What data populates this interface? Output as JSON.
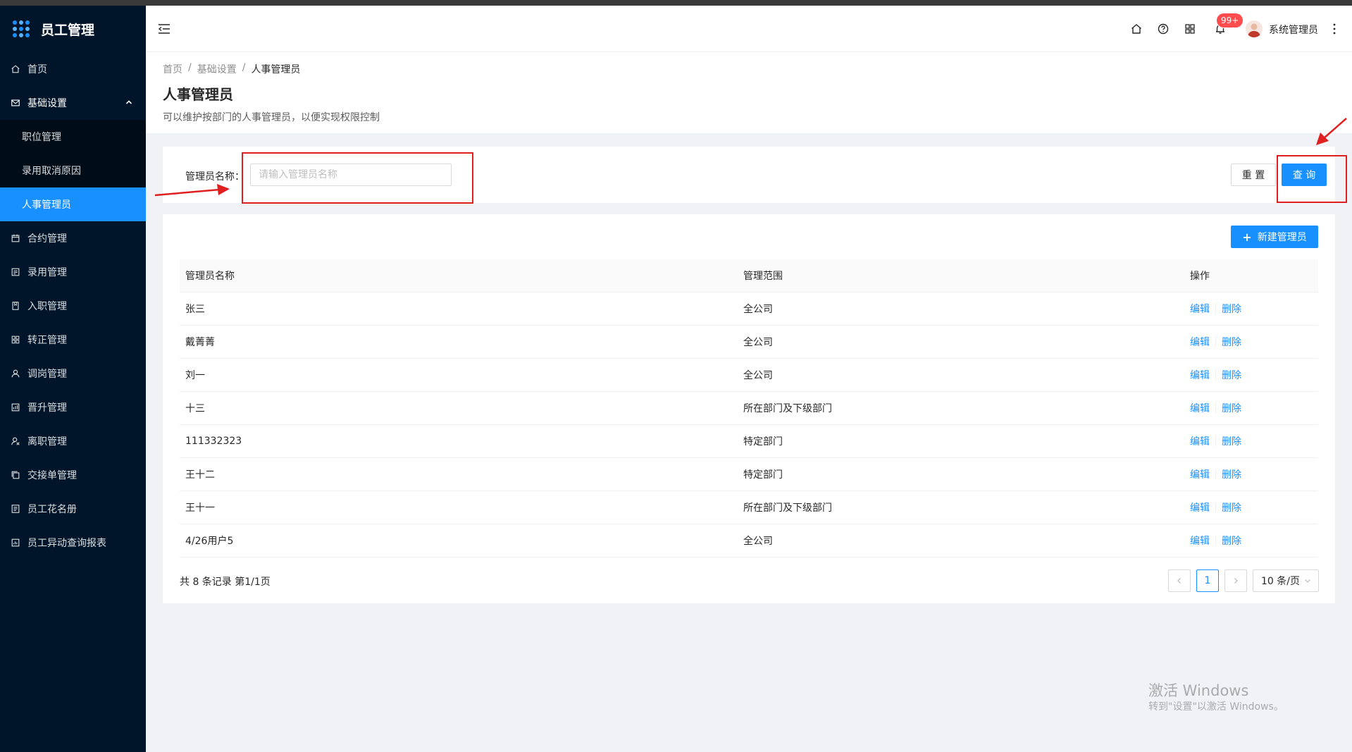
{
  "app": {
    "title": "员工管理"
  },
  "sidebar": {
    "items": [
      {
        "label": "首页",
        "icon": "home-icon"
      },
      {
        "label": "基础设置",
        "icon": "mail-icon",
        "open": true
      },
      {
        "label": "合约管理",
        "icon": "calendar-icon"
      },
      {
        "label": "录用管理",
        "icon": "profile-icon"
      },
      {
        "label": "入职管理",
        "icon": "book-icon"
      },
      {
        "label": "转正管理",
        "icon": "apps-icon"
      },
      {
        "label": "调岗管理",
        "icon": "user-icon"
      },
      {
        "label": "晋升管理",
        "icon": "rise-icon"
      },
      {
        "label": "离职管理",
        "icon": "user-delete-icon"
      },
      {
        "label": "交接单管理",
        "icon": "copy-icon"
      },
      {
        "label": "员工花名册",
        "icon": "list-icon"
      },
      {
        "label": "员工异动查询报表",
        "icon": "report-icon"
      }
    ],
    "submenu": [
      {
        "label": "职位管理"
      },
      {
        "label": "录用取消原因"
      },
      {
        "label": "人事管理员",
        "active": true
      }
    ]
  },
  "header": {
    "notification_count": "99+",
    "username": "系统管理员"
  },
  "breadcrumb": [
    "首页",
    "基础设置",
    "人事管理员"
  ],
  "page": {
    "title": "人事管理员",
    "description": "可以维护按部门的人事管理员，以便实现权限控制"
  },
  "search": {
    "label": "管理员名称：",
    "placeholder": "请输入管理员名称",
    "value": "",
    "reset_label": "重 置",
    "query_label": "查 询"
  },
  "table": {
    "new_label": "新建管理员",
    "columns": [
      "管理员名称",
      "管理范围",
      "操作"
    ],
    "rows": [
      {
        "name": "张三",
        "scope": "全公司"
      },
      {
        "name": "戴菁菁",
        "scope": "全公司"
      },
      {
        "name": "刘一",
        "scope": "全公司"
      },
      {
        "name": "十三",
        "scope": "所在部门及下级部门"
      },
      {
        "name": "111332323",
        "scope": "特定部门"
      },
      {
        "name": "王十二",
        "scope": "特定部门"
      },
      {
        "name": "王十一",
        "scope": "所在部门及下级部门"
      },
      {
        "name": "4/26用户5",
        "scope": "全公司"
      }
    ],
    "edit_label": "编辑",
    "delete_label": "删除"
  },
  "pagination": {
    "total_text": "共 8 条记录 第1/1页",
    "current_page": "1",
    "page_size": "10 条/页"
  },
  "watermark": {
    "line1": "激活 Windows",
    "line2": "转到\"设置\"以激活 Windows。"
  },
  "colors": {
    "primary": "#1890ff",
    "sidebar": "#001529",
    "annotation": "#e02020"
  }
}
